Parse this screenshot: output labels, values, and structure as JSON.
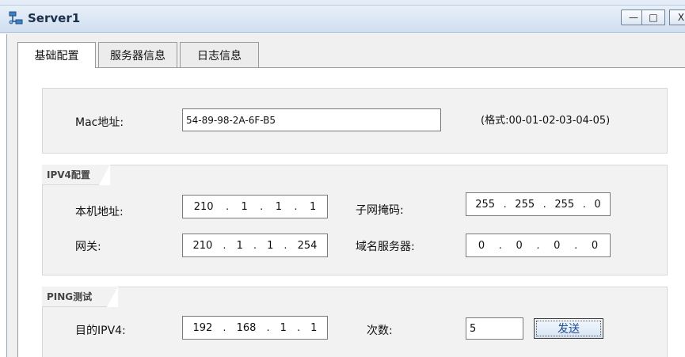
{
  "window": {
    "title": "Server1",
    "minimize_glyph": "—",
    "maximize_glyph": "□",
    "close_glyph": "X"
  },
  "tabs": [
    {
      "label": "基础配置",
      "active": true
    },
    {
      "label": "服务器信息",
      "active": false
    },
    {
      "label": "日志信息",
      "active": false
    }
  ],
  "mac": {
    "label": "Mac地址:",
    "value": "54-89-98-2A-6F-B5",
    "format_hint": "(格式:00-01-02-03-04-05)"
  },
  "ipv4": {
    "section_title": "IPV4配置",
    "host_label": "本机地址:",
    "host": [
      "210",
      "1",
      "1",
      "1"
    ],
    "mask_label": "子网掩码:",
    "mask": [
      "255",
      "255",
      "255",
      "0"
    ],
    "gateway_label": "网关:",
    "gateway": [
      "210",
      "1",
      "1",
      "254"
    ],
    "dns_label": "域名服务器:",
    "dns": [
      "0",
      "0",
      "0",
      "0"
    ]
  },
  "ping": {
    "section_title": "PING测试",
    "target_label": "目的IPV4:",
    "target": [
      "192",
      "168",
      "1",
      "1"
    ],
    "count_label": "次数:",
    "count": "5",
    "send_label": "发送"
  },
  "colors": {
    "titlebar": "#dce8f5",
    "panel_bg": "#f2f2f2",
    "button_text": "#1f4f94"
  },
  "icons": {
    "app": "network-server-icon",
    "minimize": "minimize-icon",
    "maximize": "maximize-icon",
    "close": "close-icon"
  }
}
